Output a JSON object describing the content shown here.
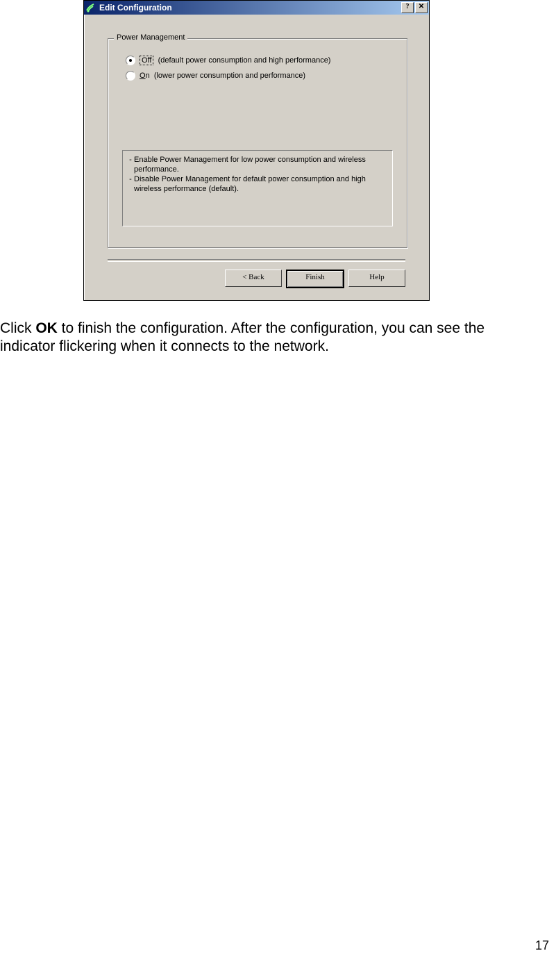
{
  "dialog": {
    "title": "Edit Configuration",
    "help_btn": "?",
    "close_btn": "✕",
    "group_title": "Power Management",
    "radios": [
      {
        "key": "Off",
        "desc": "(default power consumption and high performance)",
        "selected": true
      },
      {
        "key": "On",
        "desc": "(lower power consumption and performance)",
        "selected": false
      }
    ],
    "notes": [
      "Enable Power Management for low power consumption and wireless performance.",
      "Disable Power Management for default power consumption and high wireless performance (default)."
    ],
    "buttons": {
      "back": "< Back",
      "finish": "Finish",
      "help": "Help"
    }
  },
  "doc": {
    "pre": "Click ",
    "bold": "OK",
    "post": " to finish the configuration. After the configuration, you can see the indicator flickering when it connects to the network."
  },
  "page": "17"
}
